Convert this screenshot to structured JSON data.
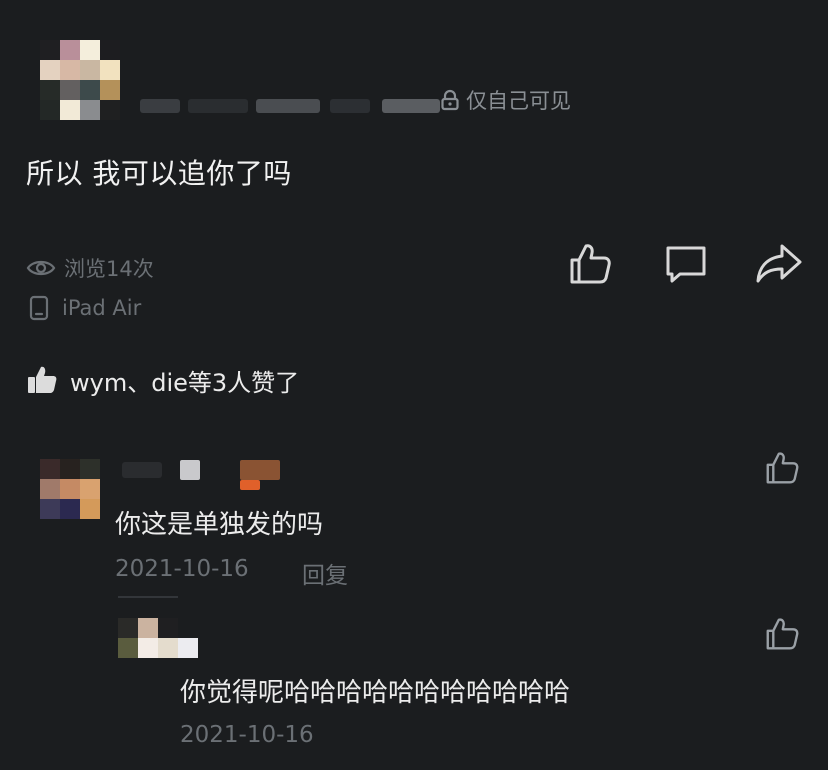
{
  "post": {
    "privacy_label": "仅自己可见",
    "text": "所以 我可以追你了吗",
    "views": "浏览14次",
    "device": "iPad Air"
  },
  "likes": {
    "summary": "wym、die等3人赞了"
  },
  "comments": [
    {
      "text": "你这是单独发的吗",
      "date": "2021-10-16",
      "reply_label": "回复"
    },
    {
      "text": "你觉得呢哈哈哈哈哈哈哈哈哈哈哈",
      "date": "2021-10-16"
    }
  ],
  "icons": {
    "privacy": "lock-icon",
    "views": "eye-icon",
    "device": "tablet-icon",
    "like": "thumbs-up-icon",
    "comment": "comment-icon",
    "share": "share-icon"
  },
  "colors": {
    "background": "#1b1d1f",
    "text_primary": "#ececec",
    "text_muted": "#6b7075",
    "icon": "#d8d8d8"
  }
}
